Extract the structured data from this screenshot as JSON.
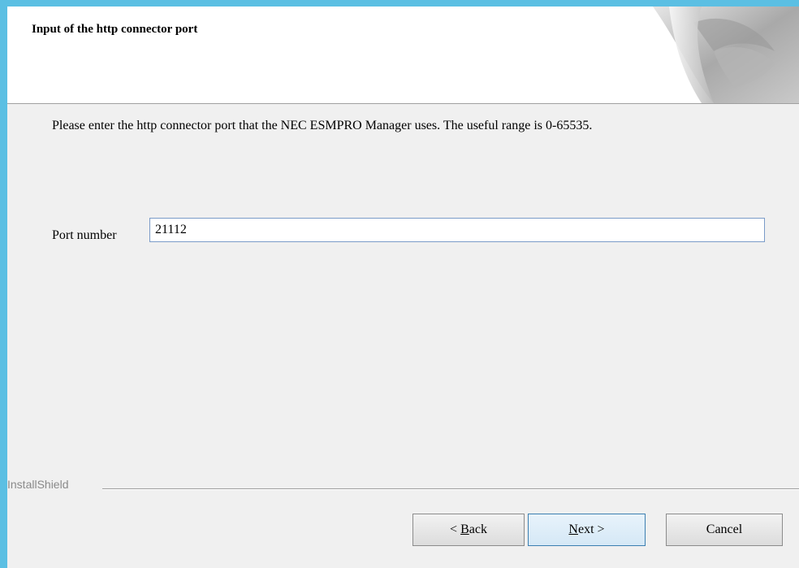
{
  "header": {
    "title": "Input of the http connector port",
    "graphic_icon": "page-curl-graphic"
  },
  "content": {
    "instruction": "Please enter the http connector port that the NEC ESMPRO Manager uses. The useful range is 0-65535.",
    "port_label": "Port number",
    "port_value": "21112"
  },
  "footer": {
    "brand": "InstallShield",
    "back_prefix": "< ",
    "back_mnemonic": "B",
    "back_rest": "ack",
    "next_mnemonic": "N",
    "next_rest": "ext >",
    "cancel_label": "Cancel"
  },
  "colors": {
    "frame_accent": "#5bbfe3",
    "dialog_background": "#f0f0f0",
    "default_button_border": "#3c7fb1"
  }
}
